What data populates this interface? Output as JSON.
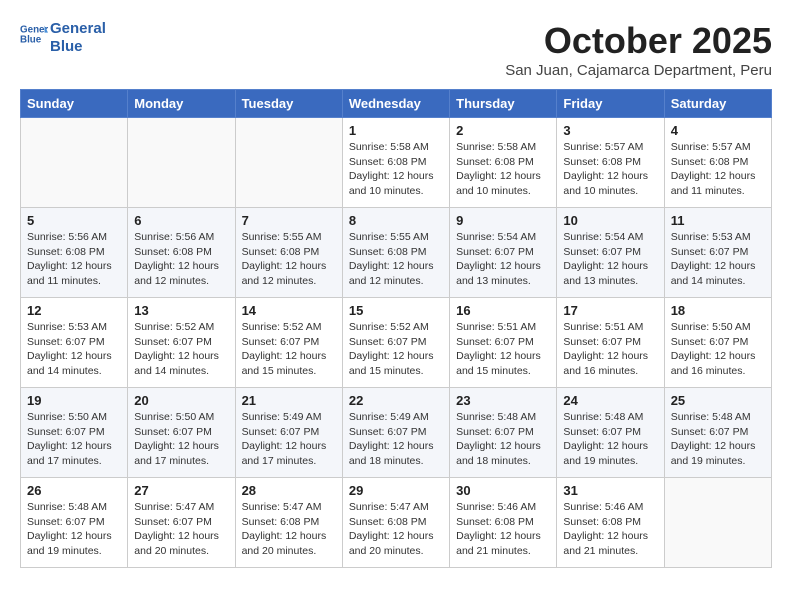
{
  "header": {
    "logo_line1": "General",
    "logo_line2": "Blue",
    "month_title": "October 2025",
    "location": "San Juan, Cajamarca Department, Peru"
  },
  "days_of_week": [
    "Sunday",
    "Monday",
    "Tuesday",
    "Wednesday",
    "Thursday",
    "Friday",
    "Saturday"
  ],
  "weeks": [
    [
      {
        "day": "",
        "sunrise": "",
        "sunset": "",
        "daylight": ""
      },
      {
        "day": "",
        "sunrise": "",
        "sunset": "",
        "daylight": ""
      },
      {
        "day": "",
        "sunrise": "",
        "sunset": "",
        "daylight": ""
      },
      {
        "day": "1",
        "sunrise": "Sunrise: 5:58 AM",
        "sunset": "Sunset: 6:08 PM",
        "daylight": "Daylight: 12 hours and 10 minutes."
      },
      {
        "day": "2",
        "sunrise": "Sunrise: 5:58 AM",
        "sunset": "Sunset: 6:08 PM",
        "daylight": "Daylight: 12 hours and 10 minutes."
      },
      {
        "day": "3",
        "sunrise": "Sunrise: 5:57 AM",
        "sunset": "Sunset: 6:08 PM",
        "daylight": "Daylight: 12 hours and 10 minutes."
      },
      {
        "day": "4",
        "sunrise": "Sunrise: 5:57 AM",
        "sunset": "Sunset: 6:08 PM",
        "daylight": "Daylight: 12 hours and 11 minutes."
      }
    ],
    [
      {
        "day": "5",
        "sunrise": "Sunrise: 5:56 AM",
        "sunset": "Sunset: 6:08 PM",
        "daylight": "Daylight: 12 hours and 11 minutes."
      },
      {
        "day": "6",
        "sunrise": "Sunrise: 5:56 AM",
        "sunset": "Sunset: 6:08 PM",
        "daylight": "Daylight: 12 hours and 12 minutes."
      },
      {
        "day": "7",
        "sunrise": "Sunrise: 5:55 AM",
        "sunset": "Sunset: 6:08 PM",
        "daylight": "Daylight: 12 hours and 12 minutes."
      },
      {
        "day": "8",
        "sunrise": "Sunrise: 5:55 AM",
        "sunset": "Sunset: 6:08 PM",
        "daylight": "Daylight: 12 hours and 12 minutes."
      },
      {
        "day": "9",
        "sunrise": "Sunrise: 5:54 AM",
        "sunset": "Sunset: 6:07 PM",
        "daylight": "Daylight: 12 hours and 13 minutes."
      },
      {
        "day": "10",
        "sunrise": "Sunrise: 5:54 AM",
        "sunset": "Sunset: 6:07 PM",
        "daylight": "Daylight: 12 hours and 13 minutes."
      },
      {
        "day": "11",
        "sunrise": "Sunrise: 5:53 AM",
        "sunset": "Sunset: 6:07 PM",
        "daylight": "Daylight: 12 hours and 14 minutes."
      }
    ],
    [
      {
        "day": "12",
        "sunrise": "Sunrise: 5:53 AM",
        "sunset": "Sunset: 6:07 PM",
        "daylight": "Daylight: 12 hours and 14 minutes."
      },
      {
        "day": "13",
        "sunrise": "Sunrise: 5:52 AM",
        "sunset": "Sunset: 6:07 PM",
        "daylight": "Daylight: 12 hours and 14 minutes."
      },
      {
        "day": "14",
        "sunrise": "Sunrise: 5:52 AM",
        "sunset": "Sunset: 6:07 PM",
        "daylight": "Daylight: 12 hours and 15 minutes."
      },
      {
        "day": "15",
        "sunrise": "Sunrise: 5:52 AM",
        "sunset": "Sunset: 6:07 PM",
        "daylight": "Daylight: 12 hours and 15 minutes."
      },
      {
        "day": "16",
        "sunrise": "Sunrise: 5:51 AM",
        "sunset": "Sunset: 6:07 PM",
        "daylight": "Daylight: 12 hours and 15 minutes."
      },
      {
        "day": "17",
        "sunrise": "Sunrise: 5:51 AM",
        "sunset": "Sunset: 6:07 PM",
        "daylight": "Daylight: 12 hours and 16 minutes."
      },
      {
        "day": "18",
        "sunrise": "Sunrise: 5:50 AM",
        "sunset": "Sunset: 6:07 PM",
        "daylight": "Daylight: 12 hours and 16 minutes."
      }
    ],
    [
      {
        "day": "19",
        "sunrise": "Sunrise: 5:50 AM",
        "sunset": "Sunset: 6:07 PM",
        "daylight": "Daylight: 12 hours and 17 minutes."
      },
      {
        "day": "20",
        "sunrise": "Sunrise: 5:50 AM",
        "sunset": "Sunset: 6:07 PM",
        "daylight": "Daylight: 12 hours and 17 minutes."
      },
      {
        "day": "21",
        "sunrise": "Sunrise: 5:49 AM",
        "sunset": "Sunset: 6:07 PM",
        "daylight": "Daylight: 12 hours and 17 minutes."
      },
      {
        "day": "22",
        "sunrise": "Sunrise: 5:49 AM",
        "sunset": "Sunset: 6:07 PM",
        "daylight": "Daylight: 12 hours and 18 minutes."
      },
      {
        "day": "23",
        "sunrise": "Sunrise: 5:48 AM",
        "sunset": "Sunset: 6:07 PM",
        "daylight": "Daylight: 12 hours and 18 minutes."
      },
      {
        "day": "24",
        "sunrise": "Sunrise: 5:48 AM",
        "sunset": "Sunset: 6:07 PM",
        "daylight": "Daylight: 12 hours and 19 minutes."
      },
      {
        "day": "25",
        "sunrise": "Sunrise: 5:48 AM",
        "sunset": "Sunset: 6:07 PM",
        "daylight": "Daylight: 12 hours and 19 minutes."
      }
    ],
    [
      {
        "day": "26",
        "sunrise": "Sunrise: 5:48 AM",
        "sunset": "Sunset: 6:07 PM",
        "daylight": "Daylight: 12 hours and 19 minutes."
      },
      {
        "day": "27",
        "sunrise": "Sunrise: 5:47 AM",
        "sunset": "Sunset: 6:07 PM",
        "daylight": "Daylight: 12 hours and 20 minutes."
      },
      {
        "day": "28",
        "sunrise": "Sunrise: 5:47 AM",
        "sunset": "Sunset: 6:08 PM",
        "daylight": "Daylight: 12 hours and 20 minutes."
      },
      {
        "day": "29",
        "sunrise": "Sunrise: 5:47 AM",
        "sunset": "Sunset: 6:08 PM",
        "daylight": "Daylight: 12 hours and 20 minutes."
      },
      {
        "day": "30",
        "sunrise": "Sunrise: 5:46 AM",
        "sunset": "Sunset: 6:08 PM",
        "daylight": "Daylight: 12 hours and 21 minutes."
      },
      {
        "day": "31",
        "sunrise": "Sunrise: 5:46 AM",
        "sunset": "Sunset: 6:08 PM",
        "daylight": "Daylight: 12 hours and 21 minutes."
      },
      {
        "day": "",
        "sunrise": "",
        "sunset": "",
        "daylight": ""
      }
    ]
  ]
}
